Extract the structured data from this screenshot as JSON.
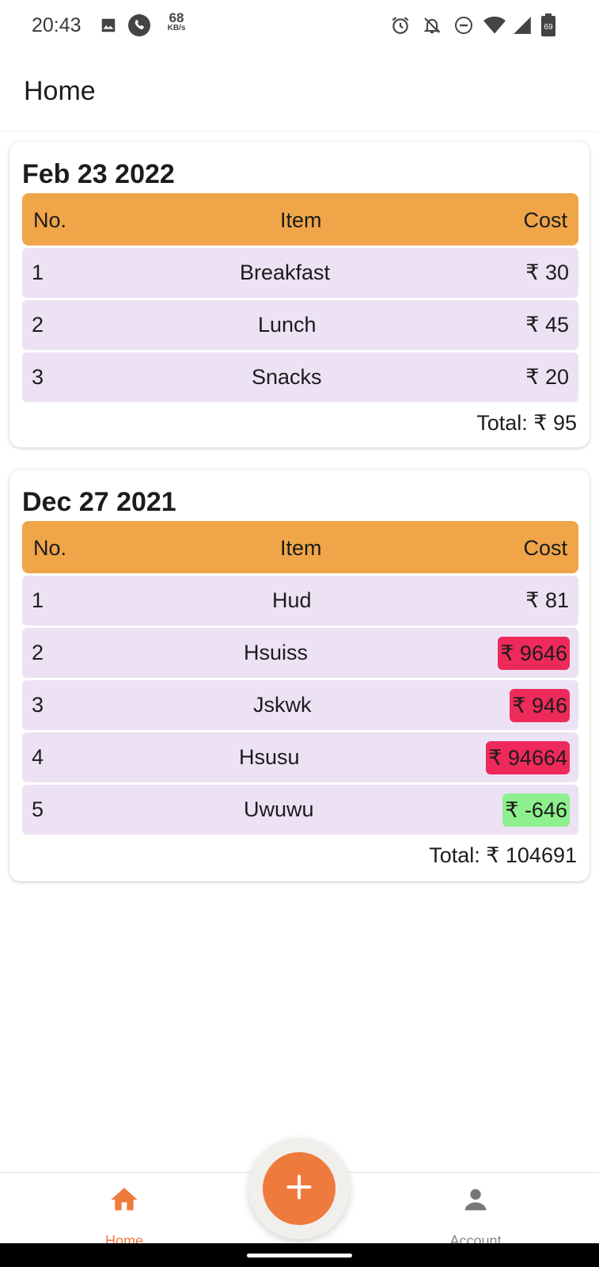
{
  "status_bar": {
    "time": "20:43",
    "net_speed_value": "68",
    "net_speed_unit": "KB/s",
    "battery_level": "69",
    "icons": [
      "image-icon",
      "phone-icon",
      "alarm-icon",
      "notifications-off-icon",
      "do-not-disturb-icon",
      "wifi-icon",
      "signal-icon",
      "battery-icon"
    ]
  },
  "app_bar": {
    "title": "Home"
  },
  "colors": {
    "header_bg": "#f0a548",
    "row_bg": "#ece2f4",
    "accent": "#ef7a3e",
    "badge_red": "#ee2a5a",
    "badge_green": "#8def8d"
  },
  "cards": [
    {
      "date": "Feb 23 2022",
      "headers": {
        "no": "No.",
        "item": "Item",
        "cost": "Cost"
      },
      "rows": [
        {
          "no": "1",
          "item": "Breakfast",
          "cost": "₹ 30"
        },
        {
          "no": "2",
          "item": "Lunch",
          "cost": "₹ 45"
        },
        {
          "no": "3",
          "item": "Snacks",
          "cost": "₹ 20"
        }
      ],
      "total": "Total: ₹ 95"
    },
    {
      "date": "Dec 27 2021",
      "headers": {
        "no": "No.",
        "item": "Item",
        "cost": "Cost"
      },
      "rows": [
        {
          "no": "1",
          "item": "Hud",
          "cost": "₹ 81",
          "highlight": "none"
        },
        {
          "no": "2",
          "item": "Hsuiss",
          "cost": "₹ 9646",
          "highlight": "red"
        },
        {
          "no": "3",
          "item": "Jskwk",
          "cost": "₹ 946",
          "highlight": "red"
        },
        {
          "no": "4",
          "item": "Hsusu",
          "cost": "₹ 94664",
          "highlight": "red"
        },
        {
          "no": "5",
          "item": "Uwuwu",
          "cost": "₹ -646",
          "highlight": "green"
        }
      ],
      "total": "Total: ₹ 104691"
    }
  ],
  "fab": {
    "icon": "plus-icon"
  },
  "bottom_nav": {
    "home": {
      "label": "Home",
      "icon": "home-icon",
      "active": true
    },
    "account": {
      "label": "Account",
      "icon": "person-icon",
      "active": false
    }
  }
}
